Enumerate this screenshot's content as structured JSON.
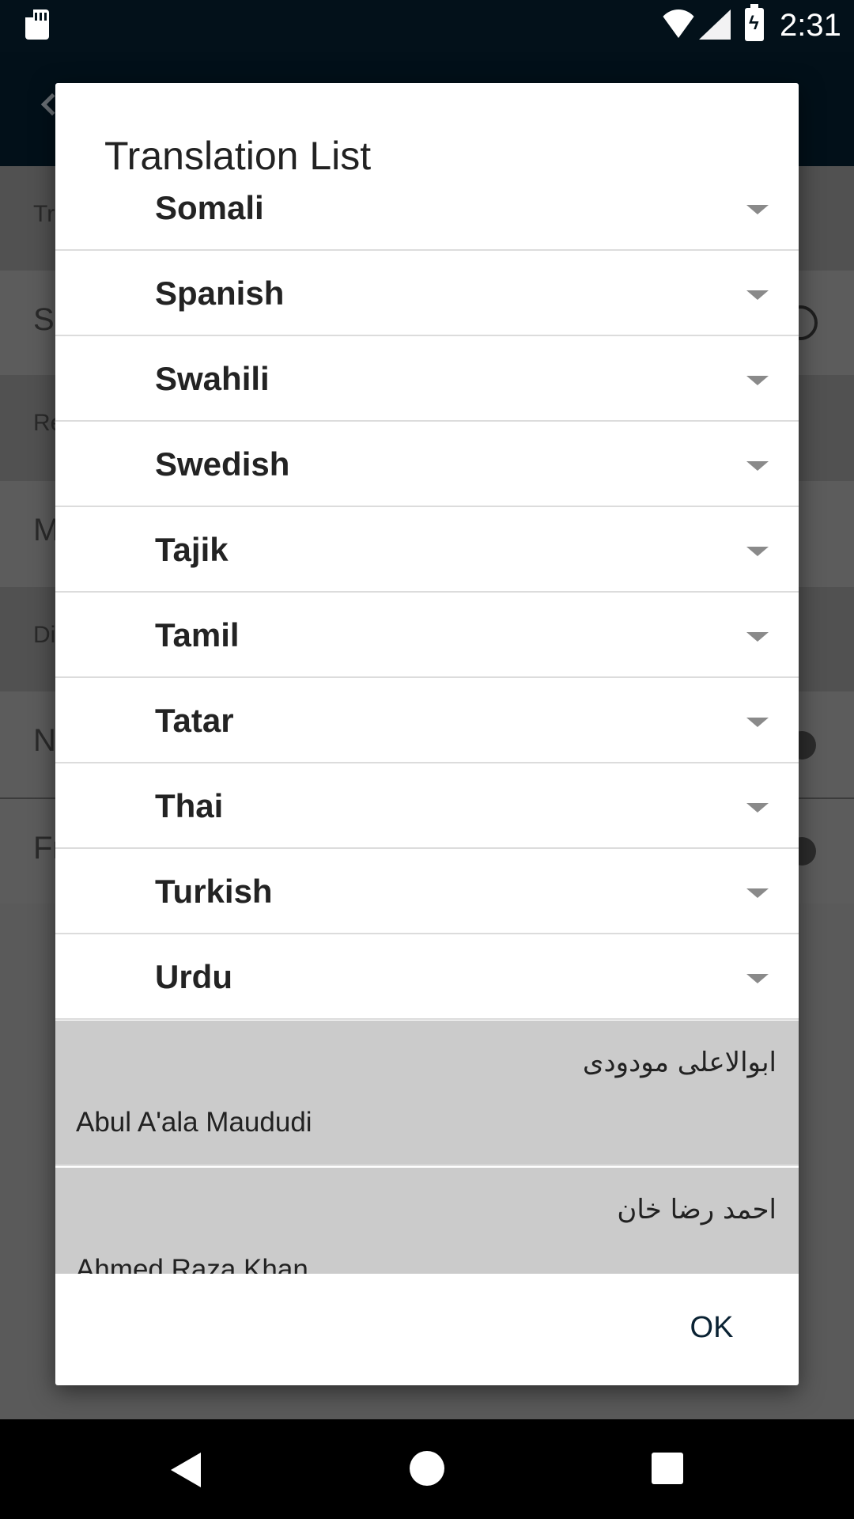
{
  "status_bar": {
    "time": "2:31",
    "icons": [
      "sd-card-icon",
      "wifi-icon",
      "signal-icon",
      "battery-charging-icon"
    ]
  },
  "background": {
    "rows": [
      "Tr",
      "S",
      "Re",
      "M",
      "Di",
      "N",
      "Fr"
    ]
  },
  "dialog": {
    "title": "Translation List",
    "languages": [
      {
        "label": "Somali"
      },
      {
        "label": "Spanish"
      },
      {
        "label": "Swahili"
      },
      {
        "label": "Swedish"
      },
      {
        "label": "Tajik"
      },
      {
        "label": "Tamil"
      },
      {
        "label": "Tatar"
      },
      {
        "label": "Thai"
      },
      {
        "label": "Turkish"
      },
      {
        "label": "Urdu"
      }
    ],
    "translations": [
      {
        "native": "ابوالاعلی مودودی",
        "latin": "Abul A'ala Maududi"
      },
      {
        "native": "احمد رضا خان",
        "latin": "Ahmed Raza Khan"
      }
    ],
    "ok_label": "OK"
  },
  "colors": {
    "status_bar": "#03111a",
    "toolbar": "#021019",
    "dim_background": "#5a5a5a",
    "translation_row": "#cbcbcb",
    "caret": "#8a8a8a",
    "ok_text": "#0a2233"
  }
}
